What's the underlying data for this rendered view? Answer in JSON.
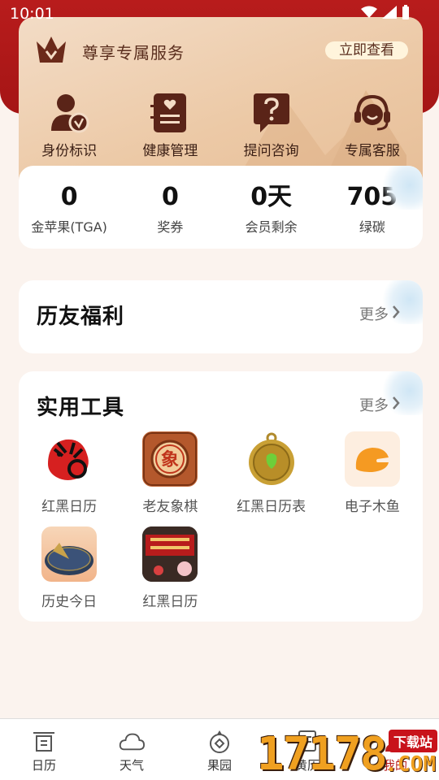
{
  "status_bar": {
    "time": "10:01"
  },
  "vip": {
    "title": "尊享专属服务",
    "view_button": "立即查看",
    "services": [
      {
        "label": "身份标识",
        "icon": "identity-badge-icon"
      },
      {
        "label": "健康管理",
        "icon": "health-record-icon"
      },
      {
        "label": "提问咨询",
        "icon": "question-chat-icon"
      },
      {
        "label": "专属客服",
        "icon": "headset-icon"
      }
    ]
  },
  "stats": [
    {
      "value": "0",
      "label": "金苹果(TGA)"
    },
    {
      "value": "0",
      "label": "奖券"
    },
    {
      "value": "0天",
      "label": "会员剩余"
    },
    {
      "value": "705",
      "label": "绿碳"
    }
  ],
  "benefits": {
    "title": "历友福利",
    "more": "更多"
  },
  "tools": {
    "title": "实用工具",
    "more": "更多",
    "items": [
      {
        "label": "红黑日历",
        "icon": "tiger-icon"
      },
      {
        "label": "老友象棋",
        "icon": "chess-piece-icon"
      },
      {
        "label": "红黑日历表",
        "icon": "pocket-watch-icon"
      },
      {
        "label": "电子木鱼",
        "icon": "wooden-fish-icon"
      },
      {
        "label": "历史今日",
        "icon": "sundial-icon"
      },
      {
        "label": "红黑日历",
        "icon": "calendar-book-icon"
      }
    ]
  },
  "bottom_nav": [
    {
      "label": "日历",
      "icon": "calendar-gate-icon"
    },
    {
      "label": "天气",
      "icon": "cloud-icon"
    },
    {
      "label": "果园",
      "icon": "orchard-icon"
    },
    {
      "label": "黄历",
      "icon": "almanac-icon"
    },
    {
      "label": "我的",
      "icon": "profile-icon"
    }
  ],
  "watermark": {
    "number": "17178",
    "tag": "下载站",
    "domain": ".COM"
  },
  "colors": {
    "brand_red": "#b81c1c",
    "gold_bg": "#ecc9a6",
    "icon_brown": "#5a2418"
  }
}
